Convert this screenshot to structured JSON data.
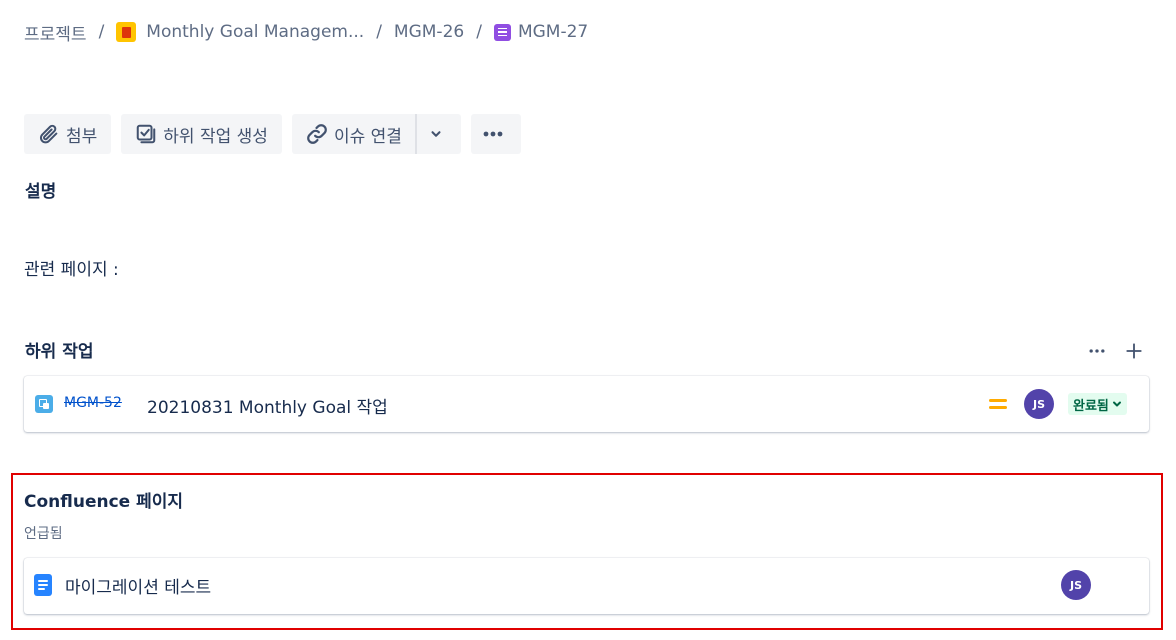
{
  "breadcrumb": {
    "root": "프로젝트",
    "separator": "/",
    "project": "Monthly Goal Managem...",
    "parent": "MGM-26",
    "current": "MGM-27"
  },
  "toolbar": {
    "attach_label": "첨부",
    "create_subtask_label": "하위 작업 생성",
    "link_issue_label": "이슈 연결"
  },
  "description": {
    "heading": "설명",
    "text": "관련 페이지 :"
  },
  "subtasks": {
    "heading": "하위 작업",
    "items": [
      {
        "key": "MGM-52",
        "summary": "20210831 Monthly Goal 작업",
        "assignee_initials": "JS",
        "status": "완료됨"
      }
    ]
  },
  "confluence": {
    "heading": "Confluence 페이지",
    "subheading": "언급됨",
    "pages": [
      {
        "title": "마이그레이션 테스트",
        "author_initials": "JS"
      }
    ]
  },
  "colors": {
    "text": "#172b4d",
    "subtle_text": "#5e6c84",
    "link": "#0052cc",
    "avatar": "#5243aa",
    "status_done_bg": "#e3fcef",
    "status_done_text": "#006644",
    "priority_medium": "#ffab00",
    "highlight_border": "#e00000"
  },
  "icons": {
    "project": "project-flag-icon",
    "parent_issue": "story-icon",
    "attach": "paperclip-icon",
    "subtask": "subtask-checklist-icon",
    "link": "link-icon",
    "dropdown": "chevron-down-icon",
    "more": "more-icon",
    "add": "plus-icon",
    "priority": "priority-medium-icon",
    "confluence_page": "page-icon"
  }
}
